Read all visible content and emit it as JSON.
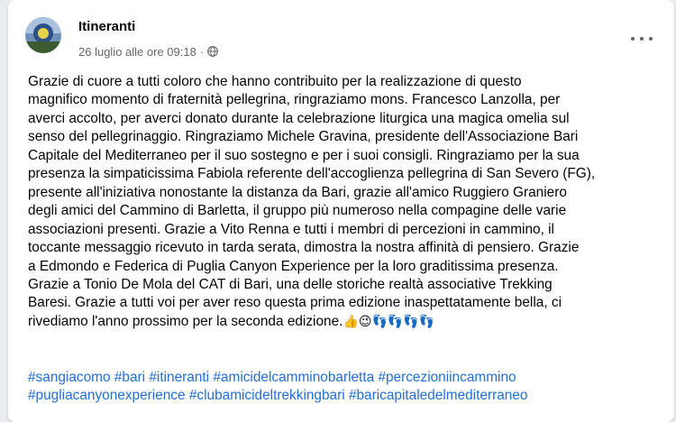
{
  "post": {
    "author": "Itineranti",
    "timestamp": "26 luglio alle ore 09:18",
    "separator": "·",
    "privacy_icon": "globe-icon",
    "menu_icon": "more-options-icon",
    "body_lines": [
      "Grazie di cuore a tutti coloro che hanno contribuito per la realizzazione di questo",
      "magnifico momento di fraternità pellegrina, ringraziamo mons. Francesco Lanzolla, per",
      "averci accolto, per averci donato durante la celebrazione liturgica una magica omelia sul",
      "senso del pellegrinaggio. Ringraziamo Michele Gravina, presidente dell'Associazione Bari",
      "Capitale del Mediterraneo per il suo sostegno e per i suoi consigli. Ringraziamo per la sua",
      "presenza la simpaticissima Fabiola referente dell'accoglienza pellegrina di San Severo (FG),",
      "presente all'iniziativa nonostante la distanza da Bari, grazie all'amico Ruggiero Graniero",
      "degli amici del Cammino di Barletta, il gruppo più numeroso nella compagine delle varie",
      "associazioni presenti. Grazie a Vito Renna e tutti i membri di percezioni in cammino, il",
      "toccante messaggio ricevuto in tarda serata, dimostra la nostra affinità di pensiero. Grazie",
      "a Edmondo e Federica di Puglia Canyon Experience per la loro  graditissima presenza.",
      "Grazie a Tonio De Mola del CAT di Bari, una delle storiche realtà associative Trekking",
      "Baresi. Grazie  a tutti voi per aver reso questa prima edizione inaspettatamente  bella, ci",
      "rivediamo l'anno prossimo per la seconda edizione."
    ],
    "emoji": "👍😉👣👣👣👣",
    "hashtag_lines": [
      [
        "#sangiacomo",
        "#bari",
        "#itineranti",
        "#amicidelcamminobarletta",
        "#percezioniincammino"
      ],
      [
        "#pugliacanyonexperience",
        "#clubamicideltrekkingbari",
        "#baricapitaledelmediterraneo"
      ]
    ],
    "colors": {
      "text": "#050505",
      "meta": "#65676b",
      "hashtag": "#216fdb",
      "background": "#e9ebee",
      "card": "#ffffff"
    }
  }
}
